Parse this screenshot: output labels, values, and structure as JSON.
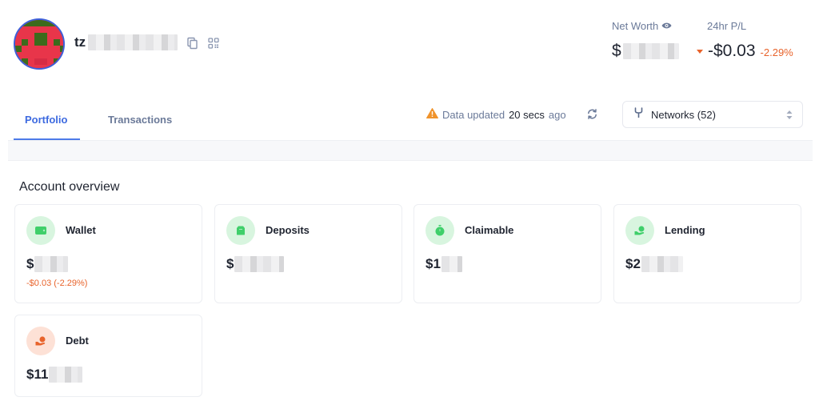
{
  "header": {
    "address_prefix": "tz",
    "net_worth_label": "Net Worth",
    "net_worth_currency": "$",
    "pl_label": "24hr P/L",
    "pl_value": "-$0.03",
    "pl_percent": "-2.29%",
    "pl_color": "#e8632b"
  },
  "tabs": [
    {
      "label": "Portfolio",
      "active": true
    },
    {
      "label": "Transactions",
      "active": false
    }
  ],
  "status": {
    "prefix": "Data updated",
    "time": "20 secs",
    "suffix": "ago"
  },
  "networks": {
    "label": "Networks (52)"
  },
  "overview": {
    "title": "Account overview",
    "cards": [
      {
        "title": "Wallet",
        "value_prefix": "$",
        "delta": "-$0.03 (-2.29%)",
        "icon": "wallet-icon"
      },
      {
        "title": "Deposits",
        "value_prefix": "$",
        "icon": "deposit-icon"
      },
      {
        "title": "Claimable",
        "value_prefix": "$1",
        "icon": "timer-icon"
      },
      {
        "title": "Lending",
        "value_prefix": "$2",
        "icon": "lending-icon"
      },
      {
        "title": "Debt",
        "value_prefix": "$11",
        "icon": "debt-icon"
      }
    ]
  },
  "colors": {
    "accent": "#3d6ae0",
    "negative": "#e8632b",
    "icon_green": "#3fcf6a",
    "icon_orange": "#e8632b"
  }
}
